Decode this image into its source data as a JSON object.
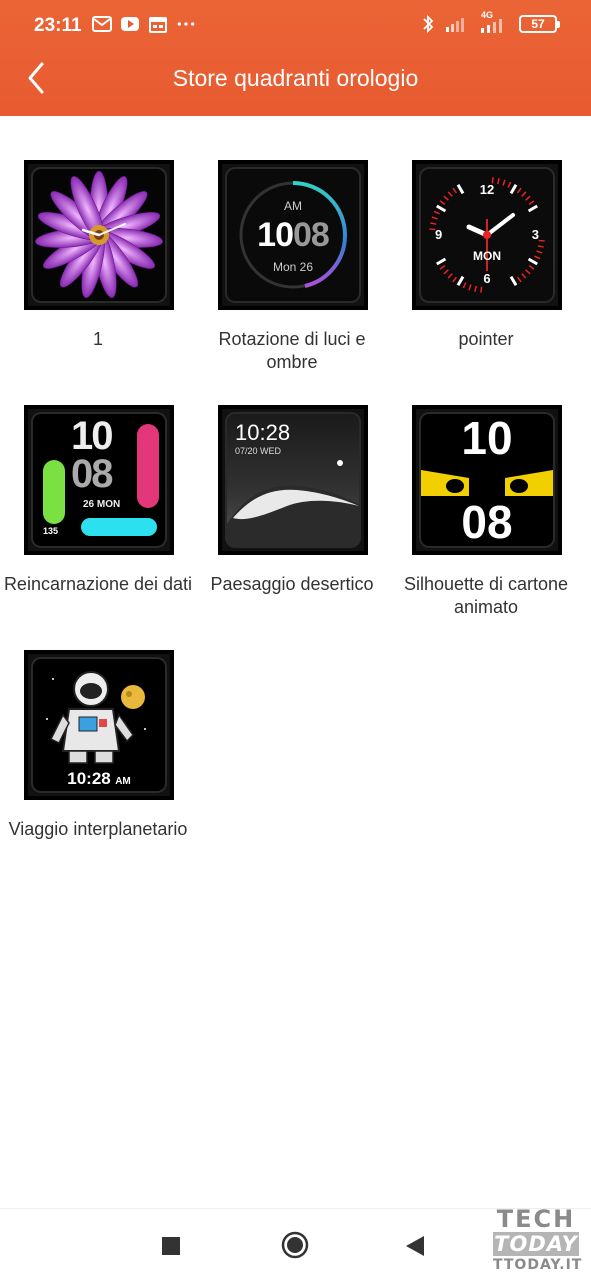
{
  "statusbar": {
    "time": "23:11",
    "battery": "57",
    "icons": [
      "gmail-icon",
      "youtube-icon",
      "calendar-icon",
      "more-dots-icon",
      "bluetooth-icon",
      "signal-icon",
      "signal-4g-icon",
      "battery-icon"
    ],
    "network": "4G"
  },
  "header": {
    "title": "Store quadranti orologio",
    "back_icon": "back-chevron-icon",
    "colors": {
      "bar": "#e85a30",
      "text": "#ffffff"
    }
  },
  "watchfaces": [
    {
      "label": "1",
      "style": "flower"
    },
    {
      "label": "Rotazione di luci e ombre",
      "style": "digital-ring",
      "am": "AM",
      "hour": "10",
      "minute": "08",
      "date": "Mon 26"
    },
    {
      "label": "pointer",
      "style": "analog",
      "n12": "12",
      "n3": "3",
      "n6": "6",
      "n9": "9",
      "day": "MON"
    },
    {
      "label": "Reincarnazione dei dati",
      "style": "data",
      "hour": "10",
      "minute": "08",
      "date": "26 MON",
      "steps": "135"
    },
    {
      "label": "Paesaggio desertico",
      "style": "desert",
      "time": "10:28",
      "date": "07/20 WED"
    },
    {
      "label": "Silhouette di cartone animato",
      "style": "cartoon",
      "hour": "10",
      "minute": "08"
    },
    {
      "label": "Viaggio interplanetario",
      "style": "astronaut",
      "time": "10:28",
      "ampm": "AM"
    }
  ],
  "bottom_nav": {
    "icons": [
      "recent-apps-icon",
      "home-icon",
      "back-triangle-icon"
    ]
  },
  "watermark": {
    "line1": "TECH",
    "line2": "TODAY",
    "line3": "TTODAY.IT"
  }
}
